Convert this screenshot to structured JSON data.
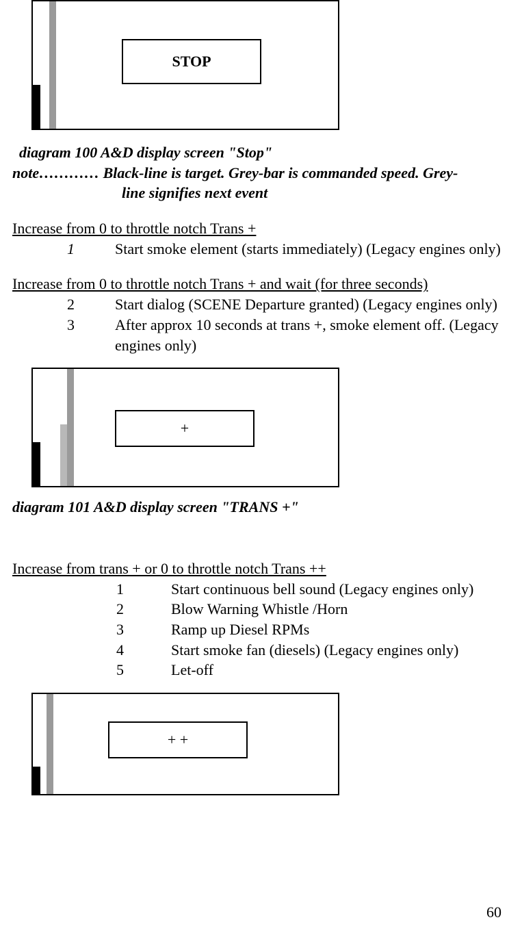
{
  "diagram100": {
    "label": "STOP",
    "caption": "diagram 100 A&D display screen \"Stop\"",
    "note_prefix": "note…………",
    "note_line1": "Black-line is target. Grey-bar is commanded speed. Grey-",
    "note_line2": "line signifies next event"
  },
  "section1": {
    "heading": "Increase from 0 to throttle notch Trans +",
    "items": [
      {
        "num": "1",
        "text": "Start smoke element (starts immediately) (Legacy engines only)"
      }
    ]
  },
  "section2": {
    "heading": "Increase from 0 to throttle notch Trans + and wait (for three seconds)",
    "items": [
      {
        "num": "2",
        "text": "Start dialog (SCENE Departure granted) (Legacy engines only)"
      },
      {
        "num": "3",
        "text": "After approx 10 seconds at trans +, smoke element off. (Legacy engines only)"
      }
    ]
  },
  "diagram101": {
    "label": "+",
    "caption": "diagram 101 A&D display screen \"TRANS +\""
  },
  "section3": {
    "heading": "Increase from trans + or 0 to throttle notch Trans ++",
    "items": [
      {
        "num": "1",
        "text": "Start continuous bell sound (Legacy engines only)"
      },
      {
        "num": "2",
        "text": "Blow Warning Whistle /Horn"
      },
      {
        "num": "3",
        "text": "Ramp up Diesel RPMs"
      },
      {
        "num": "4",
        "text": "Start smoke fan (diesels) (Legacy engines only)"
      },
      {
        "num": "5",
        "text": "Let-off"
      }
    ]
  },
  "diagram102": {
    "label": "+ +"
  },
  "page_number": "60"
}
